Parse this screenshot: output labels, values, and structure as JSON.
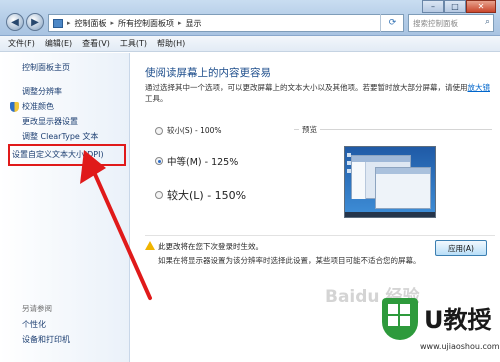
{
  "address_bar": {
    "crumbs": [
      "控制面板",
      "所有控制面板项",
      "显示"
    ]
  },
  "search": {
    "placeholder": "搜索控制面板"
  },
  "menu": [
    "文件(F)",
    "编辑(E)",
    "查看(V)",
    "工具(T)",
    "帮助(H)"
  ],
  "sidebar": {
    "home": "控制面板主页",
    "items": [
      "调整分辨率",
      "校准颜色",
      "更改显示器设置",
      "调整 ClearType 文本",
      "设置自定义文本大小(DPI)"
    ],
    "see_also_heading": "另请参阅",
    "see_also": [
      "个性化",
      "设备和打印机"
    ]
  },
  "main": {
    "title": "使阅读屏幕上的内容更容易",
    "desc_part1": "通过选择其中一个选项，可以更改屏幕上的文本大小以及其他项。若要暂时放大部分屏幕，请使用",
    "desc_link": "放大镜",
    "desc_part2": "工具。",
    "options": [
      {
        "label": "较小(S) - 100%",
        "selected": false
      },
      {
        "label": "中等(M) - 125%",
        "selected": true
      },
      {
        "label": "较大(L) - 150%",
        "selected": false
      }
    ],
    "preview_label": "预览",
    "warning": "此更改将在您下次登录时生效。",
    "note": "如果在将显示器设置为该分辨率时选择此设置，某些项目可能不适合您的屏幕。",
    "apply": "应用(A)"
  },
  "watermark": {
    "baidu": "Baidu 经验",
    "brand": "U教授",
    "url": "www.ujiaoshou.com"
  },
  "colors": {
    "annotation": "#e01a1a",
    "link": "#1d3f72",
    "title": "#1e4e8c"
  }
}
